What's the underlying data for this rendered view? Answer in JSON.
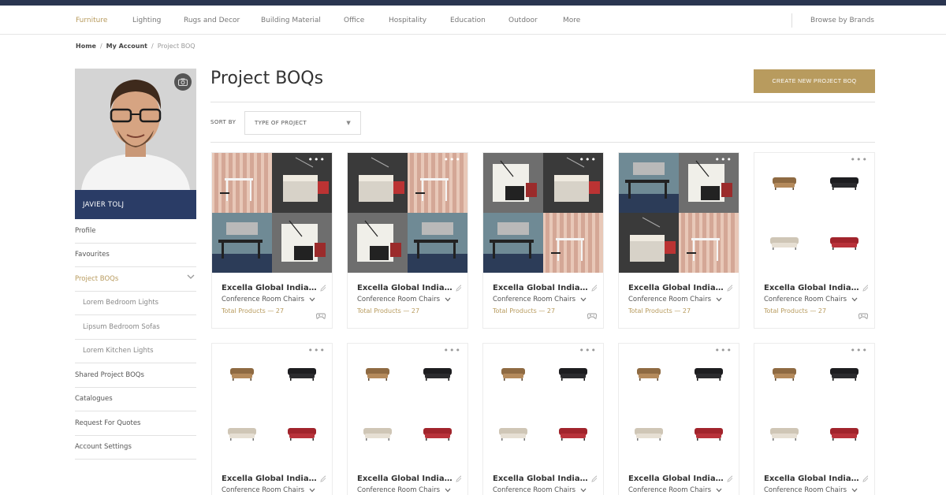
{
  "nav": {
    "items": [
      "Furniture",
      "Lighting",
      "Rugs and Decor",
      "Building Material",
      "Office",
      "Hospitality",
      "Education",
      "Outdoor",
      "More"
    ],
    "active": "Furniture",
    "brands": "Browse by Brands"
  },
  "breadcrumb": {
    "home": "Home",
    "account": "My Account",
    "current": "Project BOQ"
  },
  "profile": {
    "name": "JAVIER TOLJ"
  },
  "sidebar": {
    "items": [
      {
        "label": "Profile"
      },
      {
        "label": "Favourites"
      },
      {
        "label": "Project BOQs"
      },
      {
        "label": "Lorem Bedroom Lights"
      },
      {
        "label": "Lipsum Bedroom Sofas"
      },
      {
        "label": "Lorem Kitchen Lights"
      },
      {
        "label": "Shared Project BOQs"
      },
      {
        "label": "Catalogues"
      },
      {
        "label": "Request For Quotes"
      },
      {
        "label": "Account Settings"
      }
    ]
  },
  "page": {
    "title": "Project BOQs",
    "create_button": "CREATE NEW PROJECT BOQ",
    "sort_label": "SORT BY",
    "sort_value": "TYPE OF PROJECT"
  },
  "cards": [
    {
      "title": "Excella Global India Offic...",
      "subtitle": "Conference Room Chairs",
      "total": "Total Products — 27"
    },
    {
      "title": "Excella Global India Offic...",
      "subtitle": "Conference Room Chairs",
      "total": "Total Products — 27"
    },
    {
      "title": "Excella Global India Offic...",
      "subtitle": "Conference Room Chairs",
      "total": "Total Products — 27"
    },
    {
      "title": "Excella Global India Offic...",
      "subtitle": "Conference Room Chairs",
      "total": "Total Products — 27"
    },
    {
      "title": "Excella Global India Offic...",
      "subtitle": "Conference Room Chairs",
      "total": "Total Products — 27"
    },
    {
      "title": "Excella Global India Offic...",
      "subtitle": "Conference Room Chairs"
    },
    {
      "title": "Excella Global India Offic...",
      "subtitle": "Conference Room Chairs"
    },
    {
      "title": "Excella Global India Offic...",
      "subtitle": "Conference Room Chairs"
    },
    {
      "title": "Excella Global India Offic...",
      "subtitle": "Conference Room Chairs"
    },
    {
      "title": "Excella Global India Offic...",
      "subtitle": "Conference Room Chairs"
    }
  ],
  "colors": {
    "accent": "#b89b5e",
    "navy": "#2a3c66",
    "topbar": "#2a3550"
  },
  "icons": {
    "camera": "camera-icon",
    "pencil": "pencil-icon",
    "chevron": "chevron-down-icon",
    "gamepad": "gamepad-icon",
    "more": "more-dots-icon"
  }
}
